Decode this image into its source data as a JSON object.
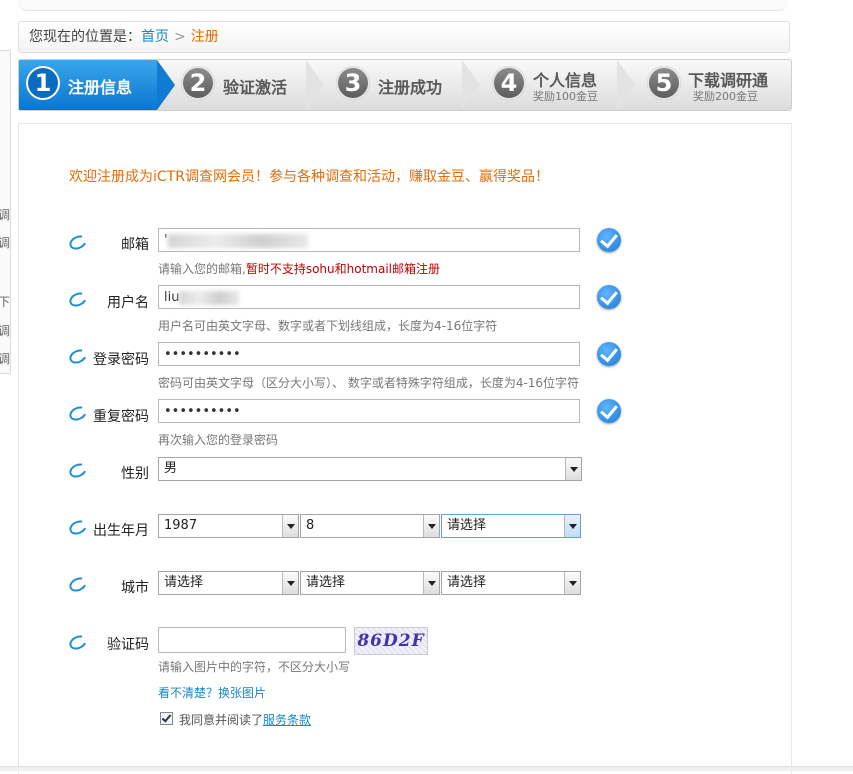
{
  "breadcrumb": {
    "lead": "您现在的位置是：",
    "home": "首页",
    "sep": ">",
    "current": "注册"
  },
  "sidebar_fragments": [
    "调",
    "调",
    "下",
    "调",
    "调"
  ],
  "steps": [
    {
      "num": "1",
      "title": "注册信息",
      "sub": ""
    },
    {
      "num": "2",
      "title": "验证激活",
      "sub": ""
    },
    {
      "num": "3",
      "title": "注册成功",
      "sub": ""
    },
    {
      "num": "4",
      "title": "个人信息",
      "sub": "奖励100金豆"
    },
    {
      "num": "5",
      "title": "下载调研通",
      "sub": "奖励200金豆"
    }
  ],
  "welcome": "欢迎注册成为iCTR调查网会员！参与各种调查和活动，赚取金豆、赢得奖品！",
  "form": {
    "email": {
      "label": "邮箱",
      "value": "'",
      "hint": "请输入您的邮箱,",
      "hint_warn": "暂时不支持sohu和hotmail邮箱注册"
    },
    "username": {
      "label": "用户名",
      "value": "liu",
      "hint": "用户名可由英文字母、数字或者下划线组成，长度为4-16位字符"
    },
    "password": {
      "label": "登录密码",
      "value": "••••••••••",
      "hint": "密码可由英文字母（区分大小写）、 数字或者特殊字符组成，长度为4-16位字符"
    },
    "repeat": {
      "label": "重复密码",
      "value": "••••••••••",
      "hint": "再次输入您的登录密码"
    },
    "gender": {
      "label": "性别",
      "value": "男"
    },
    "birth": {
      "label": "出生年月",
      "year": "1987",
      "month": "8",
      "day": "请选择"
    },
    "city": {
      "label": "城市",
      "province": "请选择",
      "city": "请选择",
      "district": "请选择"
    },
    "captcha": {
      "label": "验证码",
      "image_text": "86D2F",
      "hint": "请输入图片中的字符，不区分大小写",
      "refresh": "看不清楚？换张图片"
    },
    "agree": {
      "text": "我同意并阅读了",
      "link": "服务条款"
    }
  },
  "colors": {
    "accent": "#1a86c8",
    "welcome": "#e36c09",
    "warn": "#c00000",
    "step_active": "#1b86dc"
  }
}
